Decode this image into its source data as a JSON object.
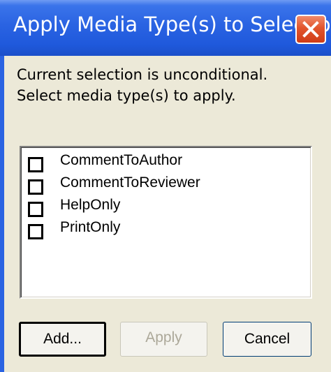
{
  "window": {
    "title": "Apply Media Type(s) to Selection",
    "close_icon": "close-icon"
  },
  "instructions": "Current selection is unconditional. Select media type(s) to apply.",
  "media_types": [
    {
      "label": "CommentToAuthor",
      "checked": false
    },
    {
      "label": "CommentToReviewer",
      "checked": false
    },
    {
      "label": "HelpOnly",
      "checked": false
    },
    {
      "label": "PrintOnly",
      "checked": false
    }
  ],
  "buttons": {
    "add": "Add...",
    "apply": "Apply",
    "apply_enabled": false,
    "cancel": "Cancel"
  },
  "colors": {
    "titlebar": "#2a63e2",
    "close_button": "#e2552d",
    "dialog_background": "#ece9d8",
    "disabled_text": "#aca899"
  }
}
